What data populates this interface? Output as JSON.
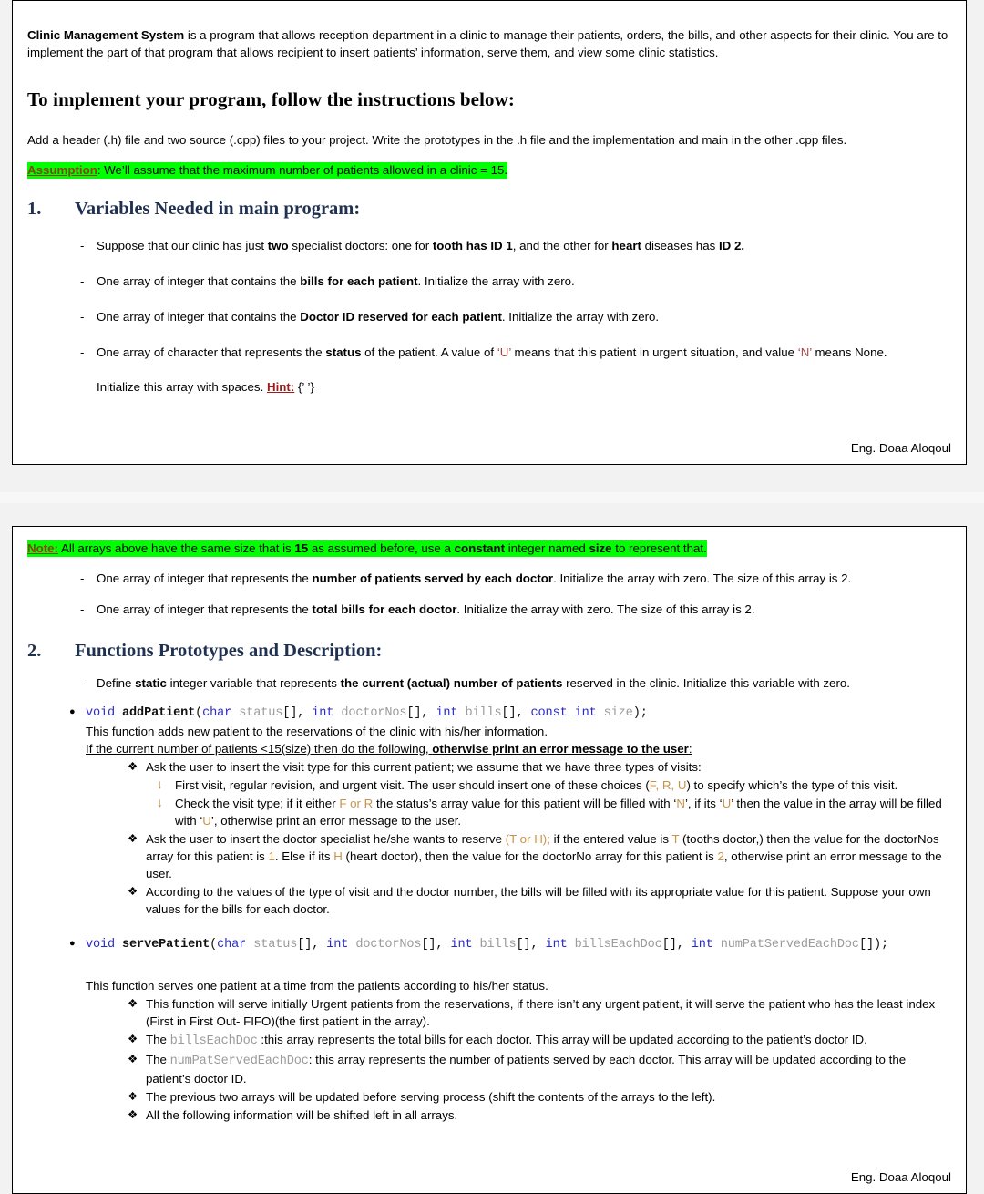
{
  "colors": {
    "heading_blue": "#1F3050",
    "highlight_green": "#00FF00",
    "keyword_red": "#923B0E",
    "char_red": "#A94442",
    "char_tan": "#C8924A",
    "code_keyword_blue": "#2A2AD0",
    "code_param_gray": "#9b9b9b",
    "arrow_bullet_orange": "#D08A2E"
  },
  "page1": {
    "intro": {
      "title": "Clinic Management System",
      "rest": " is a program that allows reception department in a clinic to manage their patients, orders, the bills, and other aspects for their clinic. You are to implement the part of that program that allows recipient to insert patients’ information, serve them, and view some clinic statistics."
    },
    "instructions_heading": "To implement your program, follow the instructions below:",
    "instructions_text": "Add a header (.h) file and two source (.cpp) files to your project. Write the prototypes in the .h file and the implementation and main in the other .cpp files.",
    "assumption": {
      "label": "Assumption",
      "colon": ":",
      "text": " We’ll assume that the maximum number of patients allowed in a clinic = 15."
    },
    "section1": {
      "number": "1.",
      "title": "Variables Needed in main program:",
      "items": [
        {
          "parts": [
            {
              "t": "Suppose that our clinic has just ",
              "s": "n"
            },
            {
              "t": "two",
              "s": "b"
            },
            {
              "t": " specialist doctors: one for ",
              "s": "n"
            },
            {
              "t": "tooth has ID 1",
              "s": "b"
            },
            {
              "t": ", and the other for ",
              "s": "n"
            },
            {
              "t": "heart",
              "s": "b"
            },
            {
              "t": " diseases has ",
              "s": "n"
            },
            {
              "t": "ID 2.",
              "s": "b"
            }
          ]
        },
        {
          "parts": [
            {
              "t": "One array of integer that contains the ",
              "s": "n"
            },
            {
              "t": "bills for each patient",
              "s": "b"
            },
            {
              "t": ". Initialize the array with zero.",
              "s": "n"
            }
          ]
        },
        {
          "parts": [
            {
              "t": "One array of integer that contains the ",
              "s": "n"
            },
            {
              "t": "Doctor ID reserved for each patient",
              "s": "b"
            },
            {
              "t": ". Initialize the array with zero.",
              "s": "n"
            }
          ]
        },
        {
          "parts": [
            {
              "t": "One array of character that represents the ",
              "s": "n"
            },
            {
              "t": "status",
              "s": "b"
            },
            {
              "t": " of the patient. A value of ",
              "s": "n"
            },
            {
              "t": "‘U’",
              "s": "red"
            },
            {
              "t": "  means that this patient in urgent situation, and value ",
              "s": "n"
            },
            {
              "t": "‘N’",
              "s": "red"
            },
            {
              "t": " means None.",
              "s": "n"
            }
          ]
        }
      ],
      "hint_line": {
        "lead": "Initialize this array with spaces. ",
        "hint_label": "Hint:",
        "hint_value": " {’   ’}"
      }
    },
    "footer": "Eng. Doaa Aloqoul"
  },
  "page2": {
    "note": {
      "label": "Note:",
      "parts": [
        {
          "t": " All arrays above have the same size that is ",
          "s": "n"
        },
        {
          "t": "15",
          "s": "b"
        },
        {
          "t": " as assumed before, use a ",
          "s": "n"
        },
        {
          "t": "constant",
          "s": "b"
        },
        {
          "t": " integer named ",
          "s": "n"
        },
        {
          "t": "size",
          "s": "b"
        },
        {
          "t": " to represent that.",
          "s": "n"
        }
      ]
    },
    "array_items": [
      {
        "parts": [
          {
            "t": "One array of integer that represents the ",
            "s": "n"
          },
          {
            "t": "number of patients served by each doctor",
            "s": "b"
          },
          {
            "t": ". Initialize the array with zero. The size of this array is 2.",
            "s": "n"
          }
        ]
      },
      {
        "parts": [
          {
            "t": "One array of integer that represents the ",
            "s": "n"
          },
          {
            "t": "total bills for each doctor",
            "s": "b"
          },
          {
            "t": ". Initialize the array with zero. The size of this array is 2.",
            "s": "n"
          }
        ]
      }
    ],
    "section2": {
      "number": "2.",
      "title": "Functions Prototypes and Description:",
      "static_item": {
        "parts": [
          {
            "t": "Define ",
            "s": "n"
          },
          {
            "t": "static",
            "s": "b"
          },
          {
            "t": " integer variable that represents ",
            "s": "n"
          },
          {
            "t": "the current (actual) number of patients",
            "s": "b"
          },
          {
            "t": " reserved in the clinic. Initialize this variable with zero.",
            "s": "n"
          }
        ]
      }
    },
    "add_patient": {
      "prototype_tokens": [
        {
          "t": "void",
          "s": "kw"
        },
        {
          "t": " ",
          "s": "pl"
        },
        {
          "t": "addPatient",
          "s": "fn"
        },
        {
          "t": "(",
          "s": "pl"
        },
        {
          "t": "char",
          "s": "kw"
        },
        {
          "t": " ",
          "s": "pl"
        },
        {
          "t": "status",
          "s": "var"
        },
        {
          "t": "[], ",
          "s": "pl"
        },
        {
          "t": "int",
          "s": "kw"
        },
        {
          "t": " ",
          "s": "pl"
        },
        {
          "t": "doctorNos",
          "s": "var"
        },
        {
          "t": "[], ",
          "s": "pl"
        },
        {
          "t": "int",
          "s": "kw"
        },
        {
          "t": " ",
          "s": "pl"
        },
        {
          "t": "bills",
          "s": "var"
        },
        {
          "t": "[], ",
          "s": "pl"
        },
        {
          "t": "const",
          "s": "kw"
        },
        {
          "t": " ",
          "s": "pl"
        },
        {
          "t": "int",
          "s": "kw"
        },
        {
          "t": " ",
          "s": "pl"
        },
        {
          "t": "size",
          "s": "var"
        },
        {
          "t": ");",
          "s": "pl"
        }
      ],
      "description": "This function adds new patient to the reservations of the clinic with his/her information.",
      "condition": {
        "normal": "If the current number of patients <15(size) then do the following, ",
        "bold": "otherwise print an error message to the user",
        "tail": ":"
      },
      "bullets": [
        {
          "type": "diamond",
          "parts": [
            {
              "t": "Ask the user to insert the visit type for this current patient; we assume that we have three types of visits:",
              "s": "n"
            }
          ]
        },
        {
          "type": "arrow",
          "parts": [
            {
              "t": "First visit, regular revision, and urgent visit.  The user should insert one of these choices (",
              "s": "n"
            },
            {
              "t": "F, R, U",
              "s": "tan"
            },
            {
              "t": ") to specify which’s the type of this visit.",
              "s": "n"
            }
          ]
        },
        {
          "type": "arrow",
          "parts": [
            {
              "t": "Check the visit type; if it either ",
              "s": "n"
            },
            {
              "t": "F or R",
              "s": "tan"
            },
            {
              "t": " the status’s array value for this patient will be filled with ‘",
              "s": "n"
            },
            {
              "t": "N",
              "s": "tan"
            },
            {
              "t": "’, if its ‘",
              "s": "n"
            },
            {
              "t": "U",
              "s": "tan"
            },
            {
              "t": "’ then the value in the array will be filled with ‘",
              "s": "n"
            },
            {
              "t": "U",
              "s": "tan"
            },
            {
              "t": "’, otherwise print an error message to the user.",
              "s": "n"
            }
          ]
        },
        {
          "type": "diamond",
          "parts": [
            {
              "t": "Ask the user to insert the doctor specialist he/she wants to reserve ",
              "s": "n"
            },
            {
              "t": "(T or H);",
              "s": "tan"
            },
            {
              "t": " if the entered value is ",
              "s": "n"
            },
            {
              "t": "T",
              "s": "tan"
            },
            {
              "t": " (tooths doctor,) then the value for the doctorNos array for this patient is ",
              "s": "n"
            },
            {
              "t": "1",
              "s": "tan"
            },
            {
              "t": ". Else if its ",
              "s": "n"
            },
            {
              "t": "H",
              "s": "tan"
            },
            {
              "t": " (heart doctor), then the value for the doctorNo array for this patient is ",
              "s": "n"
            },
            {
              "t": "2",
              "s": "tan"
            },
            {
              "t": ", otherwise print an error message to the user.",
              "s": "n"
            }
          ]
        },
        {
          "type": "diamond",
          "parts": [
            {
              "t": "According to the values of the type of visit and the doctor number, the bills will be filled with its appropriate value for this patient. Suppose your own values for the bills for each doctor.",
              "s": "n"
            }
          ]
        }
      ]
    },
    "serve_patient": {
      "prototype_tokens": [
        {
          "t": "void",
          "s": "kw"
        },
        {
          "t": " ",
          "s": "pl"
        },
        {
          "t": "servePatient",
          "s": "fn"
        },
        {
          "t": "(",
          "s": "pl"
        },
        {
          "t": "char",
          "s": "kw"
        },
        {
          "t": " ",
          "s": "pl"
        },
        {
          "t": "status",
          "s": "var"
        },
        {
          "t": "[], ",
          "s": "pl"
        },
        {
          "t": "int",
          "s": "kw"
        },
        {
          "t": " ",
          "s": "pl"
        },
        {
          "t": "doctorNos",
          "s": "var"
        },
        {
          "t": "[], ",
          "s": "pl"
        },
        {
          "t": "int",
          "s": "kw"
        },
        {
          "t": " ",
          "s": "pl"
        },
        {
          "t": "bills",
          "s": "var"
        },
        {
          "t": "[], ",
          "s": "pl"
        },
        {
          "t": "int",
          "s": "kw"
        },
        {
          "t": " ",
          "s": "pl"
        },
        {
          "t": "billsEachDoc",
          "s": "var"
        },
        {
          "t": "[], ",
          "s": "pl"
        },
        {
          "t": "int",
          "s": "kw"
        },
        {
          "t": " ",
          "s": "pl"
        },
        {
          "t": "numPatServedEachDoc",
          "s": "var"
        },
        {
          "t": "[]);",
          "s": "pl"
        }
      ],
      "description": "This function serves one patient at a time from the patients according to his/her status.",
      "bullets": [
        {
          "type": "diamond",
          "parts": [
            {
              "t": " This function will serve initially Urgent patients from the reservations, if there isn’t any urgent patient, it will serve the patient who has the least index (First in First Out- FIFO)(the first patient in the array).",
              "s": "n"
            }
          ]
        },
        {
          "type": "diamond",
          "parts": [
            {
              "t": "The ",
              "s": "n"
            },
            {
              "t": "billsEachDoc",
              "s": "code-var"
            },
            {
              "t": " :this array represents the total bills for each doctor. This array will be updated according to the patient’s doctor ID.",
              "s": "n"
            }
          ]
        },
        {
          "type": "diamond",
          "parts": [
            {
              "t": "The ",
              "s": "n"
            },
            {
              "t": "numPatServedEachDoc",
              "s": "code-var"
            },
            {
              "t": ": this array represents the number of patients served by each doctor. This array will be updated according to the patient’s doctor ID.",
              "s": "n"
            }
          ]
        },
        {
          "type": "diamond",
          "parts": [
            {
              "t": "The previous two arrays will be updated before serving process (shift the contents of the arrays to the left).",
              "s": "n"
            }
          ]
        },
        {
          "type": "diamond",
          "parts": [
            {
              "t": "All the following information will be shifted left in all arrays.",
              "s": "n"
            }
          ]
        }
      ]
    },
    "footer": "Eng. Doaa Aloqoul"
  }
}
